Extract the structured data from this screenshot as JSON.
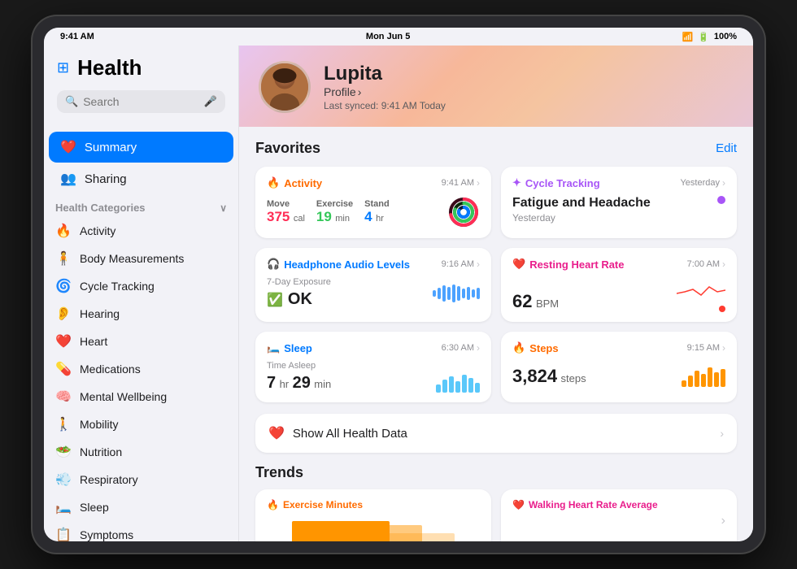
{
  "statusBar": {
    "time": "9:41 AM",
    "date": "Mon Jun 5",
    "wifi": "WiFi",
    "battery": "100%"
  },
  "sidebar": {
    "title": "Health",
    "search": {
      "placeholder": "Search"
    },
    "navItems": [
      {
        "id": "summary",
        "label": "Summary",
        "active": true,
        "icon": "❤️"
      },
      {
        "id": "sharing",
        "label": "Sharing",
        "active": false,
        "icon": "👥"
      }
    ],
    "categoriesHeader": "Health Categories",
    "categories": [
      {
        "id": "activity",
        "label": "Activity",
        "icon": "🔥"
      },
      {
        "id": "body-measurements",
        "label": "Body Measurements",
        "icon": "🧍"
      },
      {
        "id": "cycle-tracking",
        "label": "Cycle Tracking",
        "icon": "🌀"
      },
      {
        "id": "hearing",
        "label": "Hearing",
        "icon": "👂"
      },
      {
        "id": "heart",
        "label": "Heart",
        "icon": "❤️"
      },
      {
        "id": "medications",
        "label": "Medications",
        "icon": "💊"
      },
      {
        "id": "mental-wellbeing",
        "label": "Mental Wellbeing",
        "icon": "🧠"
      },
      {
        "id": "mobility",
        "label": "Mobility",
        "icon": "🚶"
      },
      {
        "id": "nutrition",
        "label": "Nutrition",
        "icon": "🥗"
      },
      {
        "id": "respiratory",
        "label": "Respiratory",
        "icon": "💨"
      },
      {
        "id": "sleep",
        "label": "Sleep",
        "icon": "🛏️"
      },
      {
        "id": "symptoms",
        "label": "Symptoms",
        "icon": "📋"
      }
    ]
  },
  "hero": {
    "name": "Lupita",
    "profileLabel": "Profile",
    "syncLabel": "Last synced: 9:41 AM Today"
  },
  "favorites": {
    "title": "Favorites",
    "editLabel": "Edit",
    "cards": [
      {
        "id": "activity",
        "title": "Activity",
        "titleColor": "orange",
        "time": "9:41 AM",
        "moveValue": "375",
        "moveUnit": "cal",
        "exerciseValue": "19",
        "exerciseUnit": "min",
        "standValue": "4",
        "standUnit": "hr"
      },
      {
        "id": "cycle-tracking",
        "title": "Cycle Tracking",
        "titleColor": "purple",
        "time": "Yesterday",
        "symptom": "Fatigue and Headache",
        "symptomDate": "Yesterday"
      },
      {
        "id": "headphone-audio",
        "title": "Headphone Audio Levels",
        "titleColor": "blue",
        "time": "9:16 AM",
        "exposureLabel": "7-Day Exposure",
        "status": "OK"
      },
      {
        "id": "resting-heart-rate",
        "title": "Resting Heart Rate",
        "titleColor": "pink",
        "time": "7:00 AM",
        "value": "62",
        "unit": "BPM"
      },
      {
        "id": "sleep",
        "title": "Sleep",
        "titleColor": "blue",
        "time": "6:30 AM",
        "timeAsleepLabel": "Time Asleep",
        "hours": "7",
        "minutes": "29",
        "hrUnit": "hr",
        "minUnit": "min"
      },
      {
        "id": "steps",
        "title": "Steps",
        "titleColor": "orange",
        "time": "9:15 AM",
        "value": "3,824",
        "unit": "steps"
      }
    ]
  },
  "showAll": {
    "label": "Show All Health Data"
  },
  "trends": {
    "title": "Trends",
    "cards": [
      {
        "id": "exercise-minutes",
        "label": "Exercise Minutes",
        "color": "orange",
        "icon": "🔥"
      },
      {
        "id": "walking-heart-rate",
        "label": "Walking Heart Rate Average",
        "color": "pink",
        "icon": "❤️"
      }
    ]
  }
}
